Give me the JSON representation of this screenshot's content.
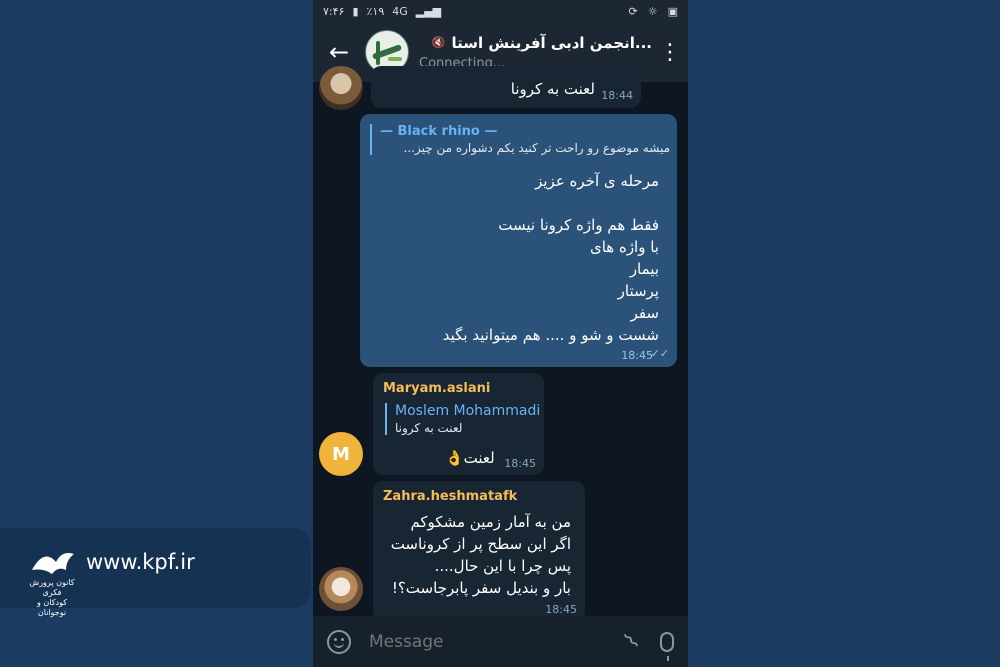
{
  "status_bar": {
    "time": "۷:۴۶",
    "battery": "٪۱۹",
    "network": "4G"
  },
  "header": {
    "title": "...انجمن ادبی آفرینش استا",
    "subtitle": "Connecting...",
    "back_icon": "arrow-left-icon",
    "menu_icon": "more-vert-icon"
  },
  "messages": [
    {
      "text": "لعنت به کرونا",
      "time": "18:44"
    },
    {
      "reply_name": "— Black rhino —",
      "reply_text": "میشه موضوع رو راحت تر کنید یکم دشواره من چیز...",
      "lines": [
        "مرحله ی آخره عزیز",
        "",
        "فقط هم واژه کرونا نیست",
        "با واژه های",
        "بیمار",
        "پرستار",
        "سفر",
        "شست و شو و .... هم میتوانید بگید"
      ],
      "time": "18:45"
    },
    {
      "sender": "Maryam.aslani",
      "avatar_letter": "M",
      "reply_name": "Moslem Mohammadi",
      "reply_text": "لعنت به کرونا",
      "text": "لعنت👌",
      "time": "18:45"
    },
    {
      "sender": "Zahra.heshmatafk",
      "lines": [
        "من به آمار زمین مشکوکم",
        "اگر این سطح پر از کروناست",
        "پس چرا با این حال....",
        "بار و بندیل سفر پابرجاست؟!"
      ],
      "time": "18:45"
    }
  ],
  "input": {
    "placeholder": "Message"
  },
  "brand": {
    "url": "www.kpf.ir",
    "org_line1": "کانون پرورش فکری",
    "org_line2": "کودکان و نوجوانان"
  },
  "colors": {
    "accent": "#6ab3f3",
    "sender": "#f5bd5a",
    "outgoing": "#2b5278",
    "incoming": "#182533"
  }
}
